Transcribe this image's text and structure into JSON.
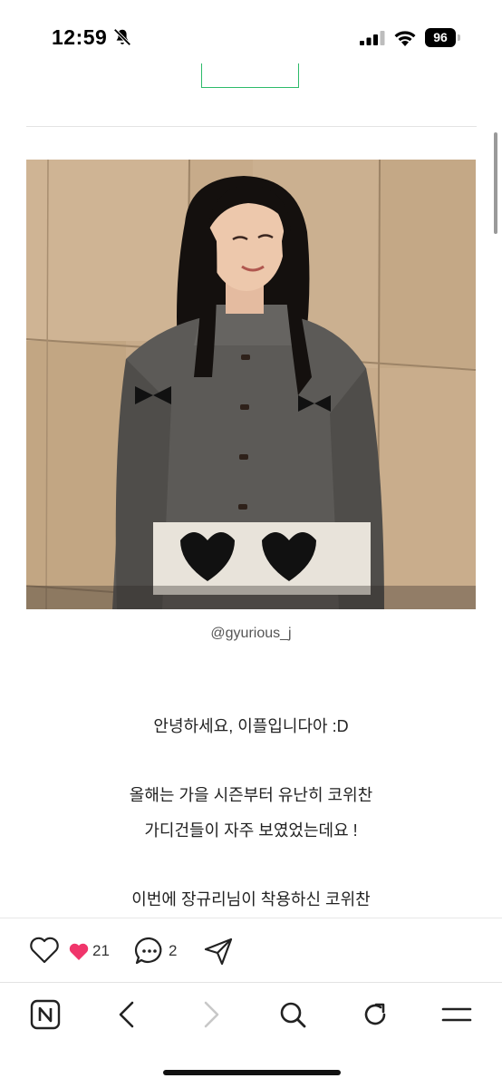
{
  "status": {
    "time": "12:59",
    "battery": "96"
  },
  "post": {
    "image_caption": "@gyurious_j",
    "lines": [
      "안녕하세요, 이플입니다아 :D",
      "올해는 가을 시즌부터 유난히 코위찬",
      "가디건들이 자주 보였었는데요 !",
      "이번에 장규리님이 착용하신 코위찬"
    ]
  },
  "actions": {
    "like_count": "21",
    "comment_count": "2"
  },
  "colors": {
    "accent_green": "#2dbb6a",
    "heart_pink": "#f0356b"
  }
}
